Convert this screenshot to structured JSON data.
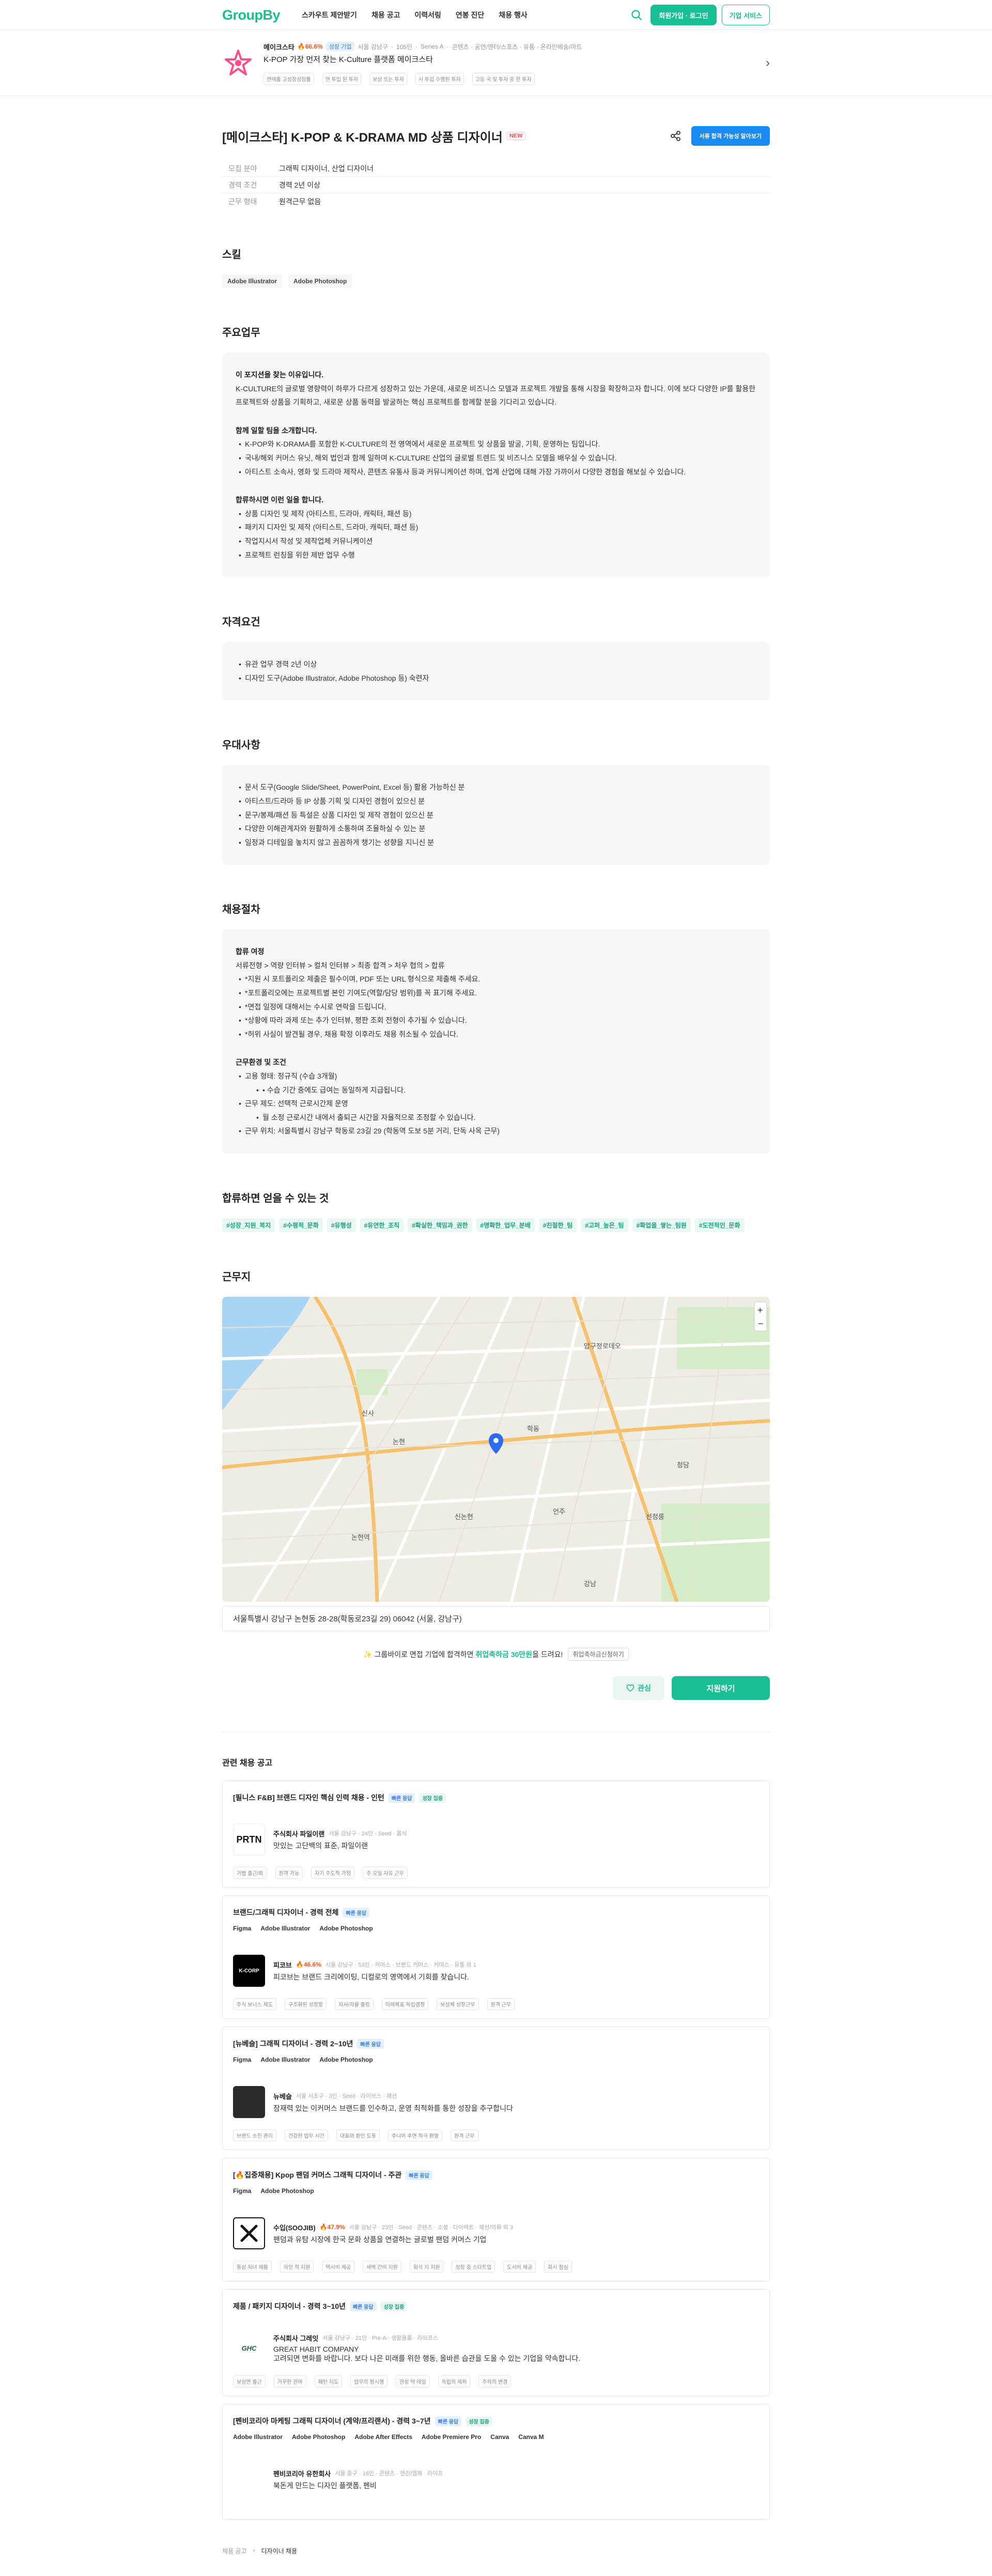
{
  "header": {
    "logo": "GroupBy",
    "nav": [
      "스카우트 제안받기",
      "채용 공고",
      "이력서링",
      "연봉 진단",
      "채용 행사"
    ],
    "login_label": "회원가입 · 로그인",
    "biz_label": "기업 서비스"
  },
  "company_bar": {
    "name": "메이크스타",
    "flame": "🔥66.6%",
    "badge": "성장 기업",
    "meta": [
      "서울 강남구",
      "105인",
      "Series A",
      "콘텐츠 · 공연/엔터/스포츠 · 유통 · 온라인배송/마트"
    ],
    "desc": "K-POP 가장 먼저 찾는 K-Culture 플랫폼 메이크스타",
    "pills": [
      "연매출 고성장성장률",
      "연 투입 된 투자",
      "보상 또는 투자",
      "시 투입 수행된 투자",
      "고등 국 및 투자 중 한 투자"
    ]
  },
  "job": {
    "title": "[메이크스타] K-POP & K-DRAMA MD 상품 디자이너",
    "new_label": "NEW",
    "apply_top_label": "서류 합격 가능성 알아보기",
    "info": [
      {
        "k": "모집 분야",
        "v": "그래픽 디자이너, 산업 디자이너"
      },
      {
        "k": "경력 조건",
        "v": "경력 2년 이상"
      },
      {
        "k": "근무 형태",
        "v": "원격근무 없음"
      }
    ]
  },
  "skills": {
    "heading": "스킬",
    "items": [
      "Adobe Illustrator",
      "Adobe Photoshop"
    ]
  },
  "duties": {
    "heading": "주요업무",
    "h1": "이 포지션을 찾는 이유입니다.",
    "p1": "K-CULTURE의 글로벌 영향력이 하루가 다르게 성장하고 있는 가운데, 새로운 비즈니스 모델과 프로젝트 개발을 통해 시장을 확장하고자 합니다. 이에 보다 다양한 IP를 활용한 프로젝트와 상품을 기획하고, 새로운 상품 동력을 발굴하는 핵심 프로젝트를 함께할 분을 기다리고 있습니다.",
    "h2": "함께 일할 팀을 소개합니다.",
    "team": [
      "K-POP와 K-DRAMA를 포함한 K-CULTURE의 전 영역에서 새로운 프로젝트 및 상품을 발굴, 기획, 운영하는 팀입니다.",
      "국내/해외 커머스 유닛, 해외 법인과 함께 일하며 K-CULTURE 산업의 글로벌 트렌드 및 비즈니스 모델을 배우실 수 있습니다.",
      "아티스트 소속사, 영화 및 드라마 제작사, 콘텐츠 유통사 등과 커뮤니케이션 하며, 업계 산업에 대해 가장 가까이서 다양한 경험을 해보실 수 있습니다."
    ],
    "h3": "합류하시면 이런 일을 합니다.",
    "tasks": [
      "상품 디자인 및 제작 (아티스트, 드라마, 캐릭터, 패션 등)",
      "패키지 디자인 및 제작 (아티스트, 드라마, 캐릭터, 패션 등)",
      "작업지시서 작성 및 제작업체 커뮤니케이션",
      "프로젝트 런칭을 위한 제반 업무 수행"
    ]
  },
  "requirements": {
    "heading": "자격요건",
    "items": [
      "유관 업무 경력 2년 이상",
      "디자인 도구(Adobe Illustrator, Adobe Photoshop 등) 숙련자"
    ]
  },
  "preferred": {
    "heading": "우대사항",
    "items": [
      "문서 도구(Google Slide/Sheet, PowerPoint, Excel 등) 활용 가능하신 분",
      "아티스트/드라마 등 IP 상품 기획 및 디자인 경험이 있으신 분",
      "문구/봉제/패션 등 특설은 상품 디자인 및 제작 경험이 있으신 분",
      "다양한 이해관계자와 원활하게 소통하며 조율하실 수 있는 분",
      "일정과 디테일을 놓치지 않고 꼼꼼하게 챙기는 성향을 지니신 분"
    ]
  },
  "process": {
    "heading": "채용절차",
    "h1": "합류 여정",
    "flow": "서류전형 > 역량 인터뷰 > 컬처 인터뷰 > 최종 합격 > 처우 협의 > 합류",
    "notes": [
      "*지원 시 포트폴리오 제출은 필수이며, PDF 또는 URL 형식으로 제출해 주세요.",
      "*포트폴리오에는 프로젝트별 본인 기여도(역할/담당 범위)를 꼭 표기해 주세요.",
      "*면접 일정에 대해서는 수시로 연락을 드립니다.",
      "*상황에 따라 과제 또는 추가 인터뷰, 평판 조회 전형이 추가될 수 있습니다.",
      "*허위 사실이 발견될 경우, 채용 확정 이후라도 채용 취소될 수 있습니다."
    ],
    "h2": "근무환경 및 조건",
    "cond1": "고용 형태: 정규직 (수습 3개월)",
    "cond1sub": "• 수습 기간 중에도 급여는 동일하게 지급됩니다.",
    "cond2": "근무 제도: 선택적 근로시간제 운영",
    "cond2sub": "월 소정 근로시간 내에서 출퇴근 시간을 자율적으로 조정할 수 있습니다.",
    "cond3": "근무 위치: 서울특별시 강남구 학동로 23길 29 (학동역 도보 5분 거리, 단독 사옥 근무)"
  },
  "benefits": {
    "heading": "합류하면 얻을 수 있는 것",
    "tags": [
      "#성장_지원_복지",
      "#수평적_문화",
      "#유행성",
      "#유연한_조직",
      "#확실한_책임과_권한",
      "#명확한_업무_분배",
      "#친절한_팀",
      "#고퍼_높은_팀",
      "#확업을_쌓는_팀원",
      "#도전적인_문화"
    ]
  },
  "location": {
    "heading": "근무지",
    "address": "서울특별시 강남구 논현동 28-28(학동로23길 29) 06042 (서울, 강남구)",
    "map_labels": [
      "논현",
      "신사",
      "학동",
      "강남",
      "압구정로데오",
      "청담",
      "언주",
      "신논현",
      "논현역",
      "선정릉"
    ]
  },
  "bonus": {
    "pre": "✨ 그룹바이로 면접 기업에 합격하면",
    "amt": "취업축하금 30만원",
    "post": "을 드려요!",
    "more": "취업축하금신청하기"
  },
  "actions": {
    "like": "관심",
    "apply": "지원하기"
  },
  "related": {
    "heading": "관련 채용 공고",
    "jobs": [
      {
        "title": "[필니스 F&B] 브랜드 디자인 핵심 인력 채용 - 인턴",
        "badges": [
          {
            "t": "빠른 응답",
            "c": "b"
          },
          {
            "t": "성장 집중",
            "c": "g"
          }
        ],
        "skills": [],
        "logo": "PRTN",
        "company": "주식회사 파일이랜",
        "meta": "서울 강남구 · 24인 · Seed · 음식",
        "desc": "맛있는 고단백의 표준, 파일이랜",
        "tags": [
          "가볍 출근/퇴",
          "원격 가능",
          "자기 주도적 가정",
          "주 오일 자유 근무"
        ]
      },
      {
        "title": "브랜드/그래픽 디자이너 - 경력 전체",
        "badges": [
          {
            "t": "빠른 응답",
            "c": "b"
          }
        ],
        "skills": [
          "Figma",
          "Adobe Illustrator",
          "Adobe Photoshop"
        ],
        "logo": "K-CORP",
        "company": "피코브",
        "flame": "🔥46.6%",
        "meta": "서울 강남구 · 53인 · 커머스 · 브랜드 커머스 · 커머스 · 유통 외 1",
        "desc": "피코브는 브랜드 크리에이팅, 디컬로의 영역에서 기회를 찾습니다.",
        "tags": [
          "주식 보너스 제도",
          "구조화된 성장발",
          "자사/자율 출장",
          "미래목표 독립결정",
          "보상체 성장근무",
          "원격 근무"
        ]
      },
      {
        "title": "[뉴베슬] 그래픽 디자이너 - 경력 2~10년",
        "badges": [
          {
            "t": "빠른 응답",
            "c": "b"
          }
        ],
        "skills": [
          "Figma",
          "Adobe Illustrator",
          "Adobe Photoshop"
        ],
        "logo": "",
        "company": "뉴베슬",
        "meta": "서울 서초구 · 3인 · Seed · 라이브스 · 패션",
        "desc": "잠재력 있는 이커머스 브랜드를 인수하고, 운영 최적화를 통한 성장을 추구합니다",
        "tags": [
          "브랜드 소진 관리",
          "건강한 업무 시간",
          "대표와 원인 도통",
          "주니어 추면 적극 환영",
          "원격 근무"
        ]
      },
      {
        "title": "[🔥집중채용] Kpop 팬덤 커머스 그래픽 디자이너 - 주관",
        "badges": [
          {
            "t": "빠른 응답",
            "c": "b"
          }
        ],
        "skills": [
          "Figma",
          "Adobe Photoshop"
        ],
        "logo": "SOO",
        "company": "수입(SOOJIB)",
        "flame": "🔥47.9%",
        "meta": "서울 강남구 · 23인 · Seed · 콘텐츠 · 소셜 · 다이렉트 · 패션/의류 외 3",
        "desc": "팬덤과 유탐 시장에 한국 문화 상품을 연결하는 글로벌 팬덤 커머스 기업",
        "tags": [
          "통상 자녀 재활",
          "자인 적 지원",
          "택시비 제공",
          "새벽 간비 지원",
          "회식 지 지원",
          "성장 중 스타트업",
          "도서비 제공",
          "회시 점심"
        ]
      },
      {
        "title": "제품 / 패키지 디자이너 - 경력 3~10년",
        "badges": [
          {
            "t": "빠른 응답",
            "c": "b"
          },
          {
            "t": "성장 집중",
            "c": "g"
          }
        ],
        "skills": [],
        "logo": "GHC",
        "company": "주식회사 그레잇",
        "meta": "서울 강남구 · 21인 · Pre-A · 생활용품 · 라이프스",
        "desc": "GREAT HABIT COMPANY\n고려되면 변화를 바랍니다. 보다 나은 미래를 위한 행동, 올바른 습관을 도울 수 있는 기업을 약속합니다.",
        "tags": [
          "보상면 출근",
          "거꾸한 관여",
          "패턴 지도",
          "업무의 평시행",
          "관성 약 레일",
          "독립의 제퍼",
          "주하의 변경"
        ]
      },
      {
        "title": "[펜비코리아 마케팅 그래픽 디자이너 (계약/프리랜서) - 경력 3~7년",
        "badges": [
          {
            "t": "빠른 응답",
            "c": "b"
          },
          {
            "t": "성장 집중",
            "c": "g"
          }
        ],
        "skills": [
          "Adobe Illustrator",
          "Adobe Photoshop",
          "Adobe After Effects",
          "Adobe Premiere Pro",
          "Canva",
          "Canva M"
        ],
        "logo": "",
        "company": "펜비코리아 유한회사",
        "meta": "서울 중구 · 16인 · 콘텐츠 · 엔진/앱패 · 라이프",
        "desc": "북돈게 만드는 디자인 플랫폼, 펜비",
        "tags": []
      }
    ]
  },
  "footer": {
    "items": [
      "채용 공고",
      "디자이너 채용"
    ]
  },
  "colors": {
    "brand": "#19bf92",
    "apply_blue": "#1a8bf5",
    "new_red": "#ff4d4d"
  }
}
